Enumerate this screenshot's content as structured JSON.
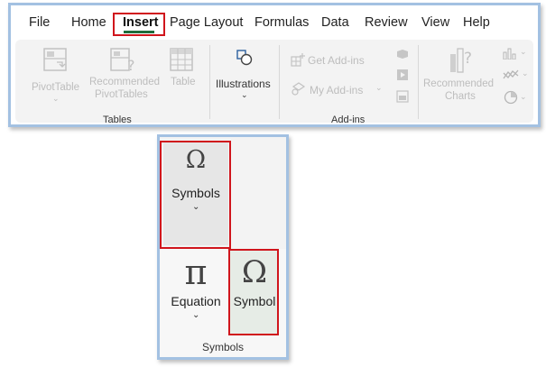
{
  "menu": {
    "tabs": [
      "File",
      "Home",
      "Insert",
      "Page Layout",
      "Formulas",
      "Data",
      "Review",
      "View",
      "Help"
    ],
    "active_tab": "Insert"
  },
  "ribbon": {
    "tables": {
      "pivot_table": "PivotTable",
      "recommended_pivot_1": "Recommended",
      "recommended_pivot_2": "PivotTables",
      "table": "Table",
      "caption": "Tables"
    },
    "illustrations": {
      "label": "Illustrations"
    },
    "addins": {
      "get_addins": "Get Add-ins",
      "my_addins": "My Add-ins",
      "caption": "Add-ins"
    },
    "charts": {
      "recommended_1": "Recommended",
      "recommended_2": "Charts"
    }
  },
  "symbols_panel": {
    "symbols_glyph": "Ω",
    "symbols_label": "Symbols",
    "equation_glyph": "π",
    "equation_label": "Equation",
    "symbol_glyph": "Ω",
    "symbol_label": "Symbol",
    "caption": "Symbols"
  },
  "colors": {
    "highlight": "#d0151c",
    "frame": "#a3c1e2",
    "active_underline": "#1f6b3a"
  }
}
